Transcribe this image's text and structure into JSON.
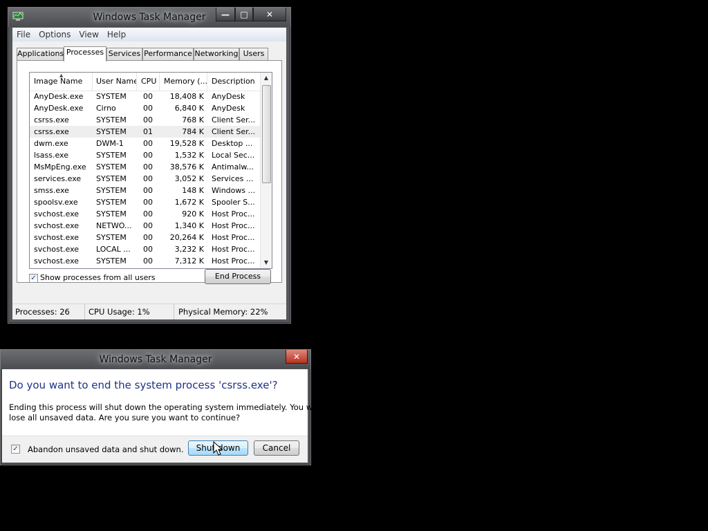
{
  "task_manager": {
    "title": "Windows Task Manager",
    "menu": [
      "File",
      "Options",
      "View",
      "Help"
    ],
    "tabs": [
      "Applications",
      "Processes",
      "Services",
      "Performance",
      "Networking",
      "Users"
    ],
    "active_tab": "Processes",
    "columns": [
      "Image Name",
      "User Name",
      "CPU",
      "Memory (...",
      "Description"
    ],
    "processes": [
      {
        "name": "AnyDesk.exe",
        "user": "SYSTEM",
        "cpu": "00",
        "memory": "18,408 K",
        "description": "AnyDesk"
      },
      {
        "name": "AnyDesk.exe",
        "user": "Cirno",
        "cpu": "00",
        "memory": "6,840 K",
        "description": "AnyDesk"
      },
      {
        "name": "csrss.exe",
        "user": "SYSTEM",
        "cpu": "00",
        "memory": "768 K",
        "description": "Client Ser..."
      },
      {
        "name": "csrss.exe",
        "user": "SYSTEM",
        "cpu": "01",
        "memory": "784 K",
        "description": "Client Ser...",
        "selected": true
      },
      {
        "name": "dwm.exe",
        "user": "DWM-1",
        "cpu": "00",
        "memory": "19,528 K",
        "description": "Desktop ..."
      },
      {
        "name": "lsass.exe",
        "user": "SYSTEM",
        "cpu": "00",
        "memory": "1,532 K",
        "description": "Local Sec..."
      },
      {
        "name": "MsMpEng.exe",
        "user": "SYSTEM",
        "cpu": "00",
        "memory": "38,576 K",
        "description": "Antimalw..."
      },
      {
        "name": "services.exe",
        "user": "SYSTEM",
        "cpu": "00",
        "memory": "3,052 K",
        "description": "Services ..."
      },
      {
        "name": "smss.exe",
        "user": "SYSTEM",
        "cpu": "00",
        "memory": "148 K",
        "description": "Windows ..."
      },
      {
        "name": "spoolsv.exe",
        "user": "SYSTEM",
        "cpu": "00",
        "memory": "1,672 K",
        "description": "Spooler S..."
      },
      {
        "name": "svchost.exe",
        "user": "SYSTEM",
        "cpu": "00",
        "memory": "920 K",
        "description": "Host Proc..."
      },
      {
        "name": "svchost.exe",
        "user": "NETWO...",
        "cpu": "00",
        "memory": "1,340 K",
        "description": "Host Proc..."
      },
      {
        "name": "svchost.exe",
        "user": "SYSTEM",
        "cpu": "00",
        "memory": "20,264 K",
        "description": "Host Proc..."
      },
      {
        "name": "svchost.exe",
        "user": "LOCAL ...",
        "cpu": "00",
        "memory": "3,232 K",
        "description": "Host Proc..."
      },
      {
        "name": "svchost.exe",
        "user": "SYSTEM",
        "cpu": "00",
        "memory": "7,312 K",
        "description": "Host Proc..."
      }
    ],
    "show_all_label": "Show processes from all users",
    "show_all_checked": true,
    "end_process_label": "End Process",
    "status": {
      "processes": "Processes: 26",
      "cpu": "CPU Usage: 1%",
      "memory": "Physical Memory: 22%"
    }
  },
  "dialog": {
    "title": "Windows Task Manager",
    "heading": "Do you want to end the system process 'csrss.exe'?",
    "message_line1": "Ending this process will shut down the operating system immediately.  You will",
    "message_line2": "lose all unsaved data.  Are you sure you want to continue?",
    "checkbox_label": "Abandon unsaved data and shut down.",
    "checkbox_checked": true,
    "shutdown_label": "Shut down",
    "cancel_label": "Cancel"
  },
  "icons": {
    "app_icon": "task-manager-icon",
    "minimize": "minimize-icon",
    "maximize": "maximize-icon",
    "close": "close-icon",
    "check": "checkmark-icon",
    "cursor": "mouse-pointer-icon"
  },
  "colors": {
    "dialog_heading": "#1e3287",
    "desktop": "#000000",
    "close_button": "#c8432f"
  }
}
